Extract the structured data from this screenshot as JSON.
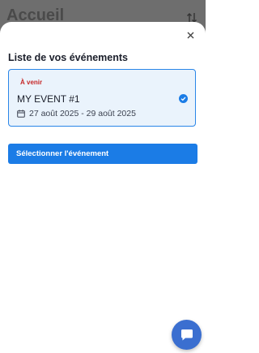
{
  "background": {
    "title": "Accueil",
    "sort_icon": "sort-arrows-icon"
  },
  "modal": {
    "title": "Liste de vos événements",
    "close_icon": "close-icon",
    "events": [
      {
        "status": "À venir",
        "name": "MY EVENT #1",
        "dates": "27 août 2025 - 29 août 2025",
        "selected": true,
        "status_color": "#c62828"
      }
    ],
    "select_button_label": "Sélectionner l'événement"
  },
  "chat": {
    "icon": "chat-bubble-icon"
  },
  "colors": {
    "accent": "#1b7ce6",
    "card_border": "#2a86e8",
    "card_bg": "#eaf3fc"
  }
}
